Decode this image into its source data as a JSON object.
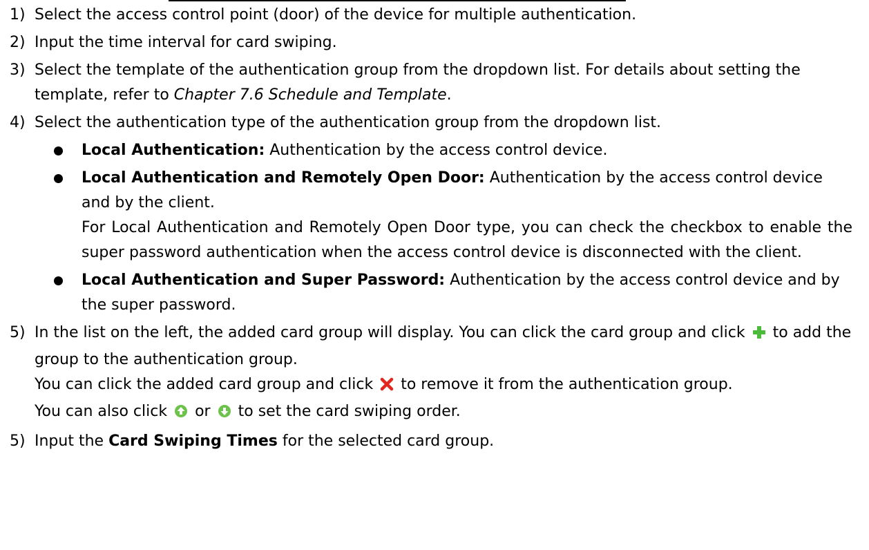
{
  "steps": [
    {
      "num": "1)",
      "text": "Select the access control point (door) of the device for multiple authentication."
    },
    {
      "num": "2)",
      "text": "Input the time interval for card swiping."
    },
    {
      "num": "3)",
      "text_before": "Select the template of the authentication group from the dropdown list. For details about setting the template, refer to ",
      "ref": "Chapter 7.6 Schedule and Template",
      "text_after": "."
    },
    {
      "num": "4)",
      "text": "Select the authentication type of the authentication group from the dropdown list."
    },
    {
      "num": "5)",
      "text_a": "In the list on the left, the added card group will display. You can click the card group and click",
      "text_b": "to add the group to the authentication group.",
      "text_c": "You can click the added card group and click",
      "text_d": "to remove it from the authentication group.",
      "text_e": "You can also click",
      "text_f": "or",
      "text_g": "to set the card swiping order."
    },
    {
      "num": "5)",
      "text_before": "Input the ",
      "bold": "Card Swiping Times",
      "text_after": " for the selected card group."
    }
  ],
  "bullets": [
    {
      "term": "Local Authentication:",
      "desc": " Authentication by the access control device."
    },
    {
      "term": "Local Authentication and Remotely Open Door:",
      "desc": " Authentication by the access control device and by the client.",
      "note": "For Local Authentication and Remotely Open Door type, you can check the checkbox to enable the super password authentication when the access control device is disconnected with the client."
    },
    {
      "term": "Local Authentication and Super Password:",
      "desc": " Authentication by the access control device and by the super password."
    }
  ],
  "icons": {
    "add": "plus-icon",
    "remove": "close-icon",
    "up": "arrow-up-circle-icon",
    "down": "arrow-down-circle-icon"
  },
  "colors": {
    "add": "#4cbb3b",
    "remove": "#e0281f",
    "arrow": "#6dc24b"
  }
}
